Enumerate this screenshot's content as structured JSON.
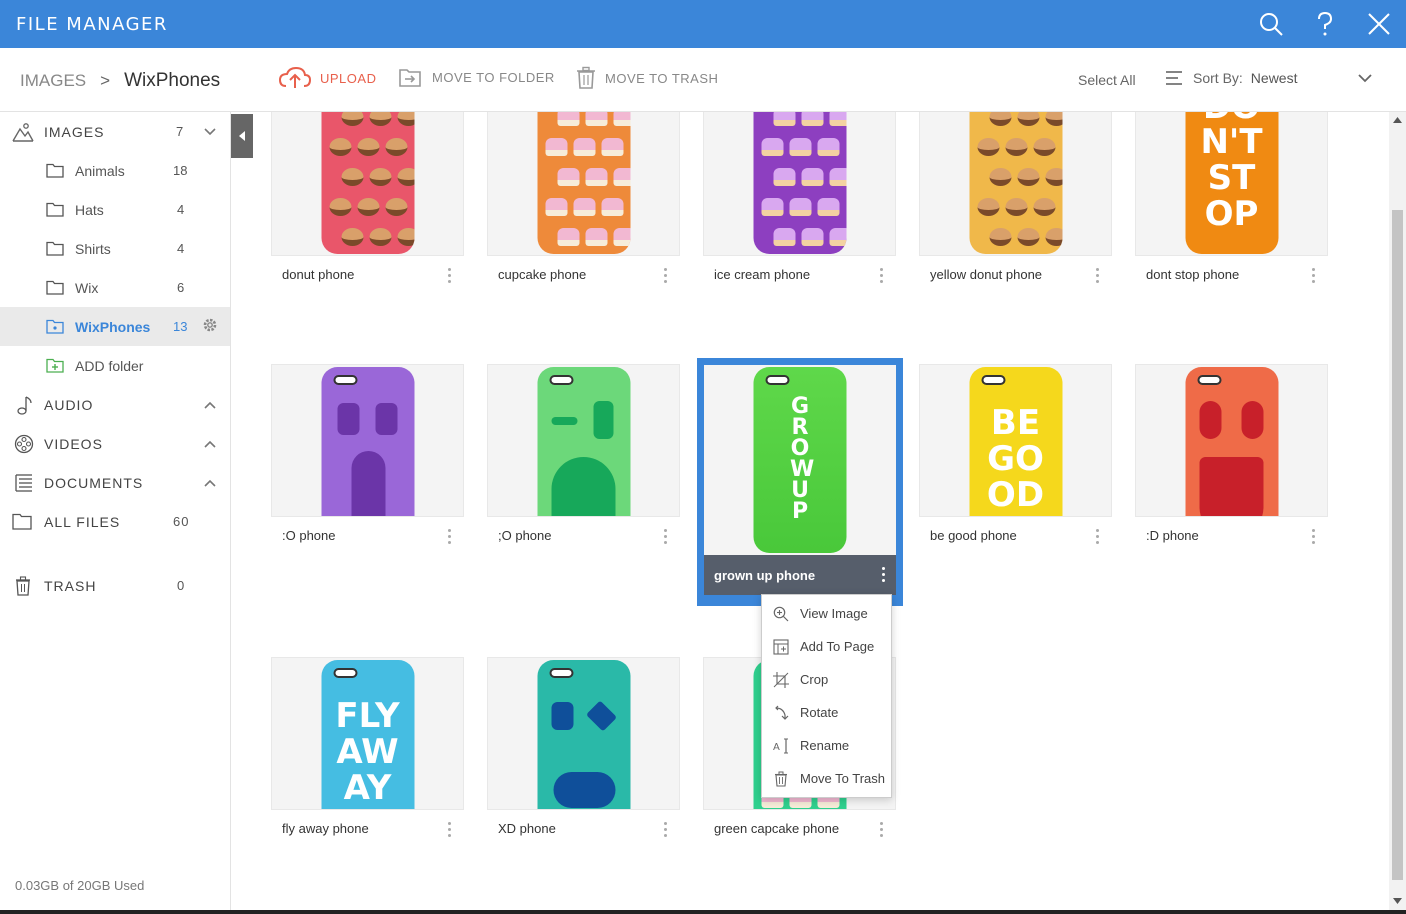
{
  "app": {
    "title": "FILE MANAGER"
  },
  "titlebar_icons": [
    "search-icon",
    "help-icon",
    "close-icon"
  ],
  "toolbar": {
    "breadcrumb_root": "IMAGES",
    "breadcrumb_sep": ">",
    "breadcrumb_current": "WixPhones",
    "upload": "UPLOAD",
    "move_to_folder": "MOVE TO FOLDER",
    "move_to_trash": "MOVE TO TRASH",
    "select_all": "Select All",
    "sort_label": "Sort By:",
    "sort_value": "Newest"
  },
  "sidebar": {
    "images": {
      "label": "IMAGES",
      "count": "7"
    },
    "folders": [
      {
        "label": "Animals",
        "count": "18"
      },
      {
        "label": "Hats",
        "count": "4"
      },
      {
        "label": "Shirts",
        "count": "4"
      },
      {
        "label": "Wix",
        "count": "6"
      },
      {
        "label": "WixPhones",
        "count": "13"
      }
    ],
    "add_folder": "ADD folder",
    "audio": "AUDIO",
    "videos": "VIDEOS",
    "documents": "DOCUMENTS",
    "all_files": {
      "label": "ALL FILES",
      "count": "60"
    },
    "trash": {
      "label": "TRASH",
      "count": "0"
    },
    "storage": "0.03GB of 20GB Used"
  },
  "files": [
    {
      "name": "donut phone",
      "color": "#e9566a",
      "art": "donuts"
    },
    {
      "name": "cupcake phone",
      "color": "#ee8a3a",
      "art": "cupcakes"
    },
    {
      "name": "ice cream phone",
      "color": "#8d3fc0",
      "art": "icecream"
    },
    {
      "name": "yellow donut phone",
      "color": "#f0b84a",
      "art": "donuts"
    },
    {
      "name": "dont stop phone",
      "color": "#f08a12",
      "art_text": "DO N'T ST OP"
    },
    {
      "name": ":O phone",
      "color": "#9a67d8",
      "art": "face-o"
    },
    {
      "name": ";O phone",
      "color": "#6cd87a",
      "art": "face-wink"
    },
    {
      "name": "grown up phone",
      "color": "#5cd23e",
      "art_text": "GROWUP"
    },
    {
      "name": "be good phone",
      "color": "#f5d81c",
      "art_text": "BE GO OD"
    },
    {
      "name": ":D phone",
      "color": "#ef6b48",
      "art": "face-d"
    },
    {
      "name": "fly away phone",
      "color": "#45bde2",
      "art_text": "FLY AW AY"
    },
    {
      "name": "XD phone",
      "color": "#2ab9a8",
      "art": "face-xd"
    },
    {
      "name": "green capcake phone",
      "color": "#2fd08e",
      "art": "cupcakes"
    }
  ],
  "selected_file": "grown up phone",
  "context_menu": [
    {
      "label": "View Image",
      "icon": "zoom-in-icon"
    },
    {
      "label": "Add To Page",
      "icon": "add-to-page-icon"
    },
    {
      "label": "Crop",
      "icon": "crop-icon"
    },
    {
      "label": "Rotate",
      "icon": "rotate-icon"
    },
    {
      "label": "Rename",
      "icon": "rename-icon"
    },
    {
      "label": "Move To Trash",
      "icon": "trash-icon"
    }
  ],
  "colors": {
    "accent": "#3b86d9",
    "upload": "#e8604c",
    "selected_bar": "#565e6b"
  }
}
